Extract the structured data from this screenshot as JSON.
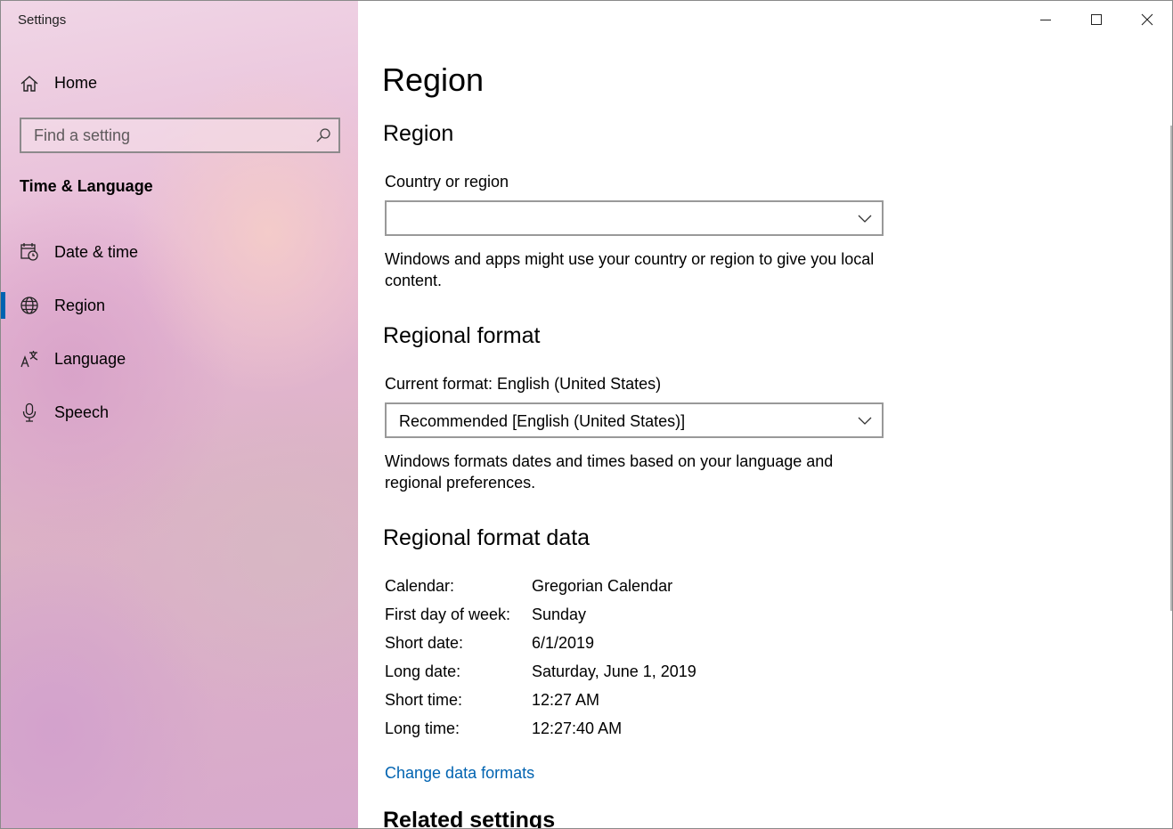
{
  "window": {
    "app_title": "Settings"
  },
  "sidebar": {
    "home_label": "Home",
    "search_placeholder": "Find a setting",
    "section_heading": "Time & Language",
    "items": [
      {
        "label": "Date & time",
        "icon": "calendar-clock-icon",
        "selected": false
      },
      {
        "label": "Region",
        "icon": "globe-icon",
        "selected": true
      },
      {
        "label": "Language",
        "icon": "language-icon",
        "selected": false
      },
      {
        "label": "Speech",
        "icon": "microphone-icon",
        "selected": false
      }
    ],
    "accent_color": "#0063b1"
  },
  "main": {
    "page_title": "Region",
    "region_section": {
      "heading": "Region",
      "field_label": "Country or region",
      "dropdown_value": "",
      "description": "Windows and apps might use your country or region to give you local content."
    },
    "format_section": {
      "heading": "Regional format",
      "current_format_label": "Current format: English (United States)",
      "dropdown_value": "Recommended [English (United States)]",
      "description": "Windows formats dates and times based on your language and regional preferences."
    },
    "format_data": {
      "heading": "Regional format data",
      "rows": [
        {
          "key": "Calendar:",
          "value": "Gregorian Calendar"
        },
        {
          "key": "First day of week:",
          "value": "Sunday"
        },
        {
          "key": "Short date:",
          "value": "6/1/2019"
        },
        {
          "key": "Long date:",
          "value": "Saturday, June 1, 2019"
        },
        {
          "key": "Short time:",
          "value": "12:27 AM"
        },
        {
          "key": "Long time:",
          "value": "12:27:40 AM"
        }
      ],
      "change_link": "Change data formats"
    },
    "related_heading": "Related settings"
  }
}
